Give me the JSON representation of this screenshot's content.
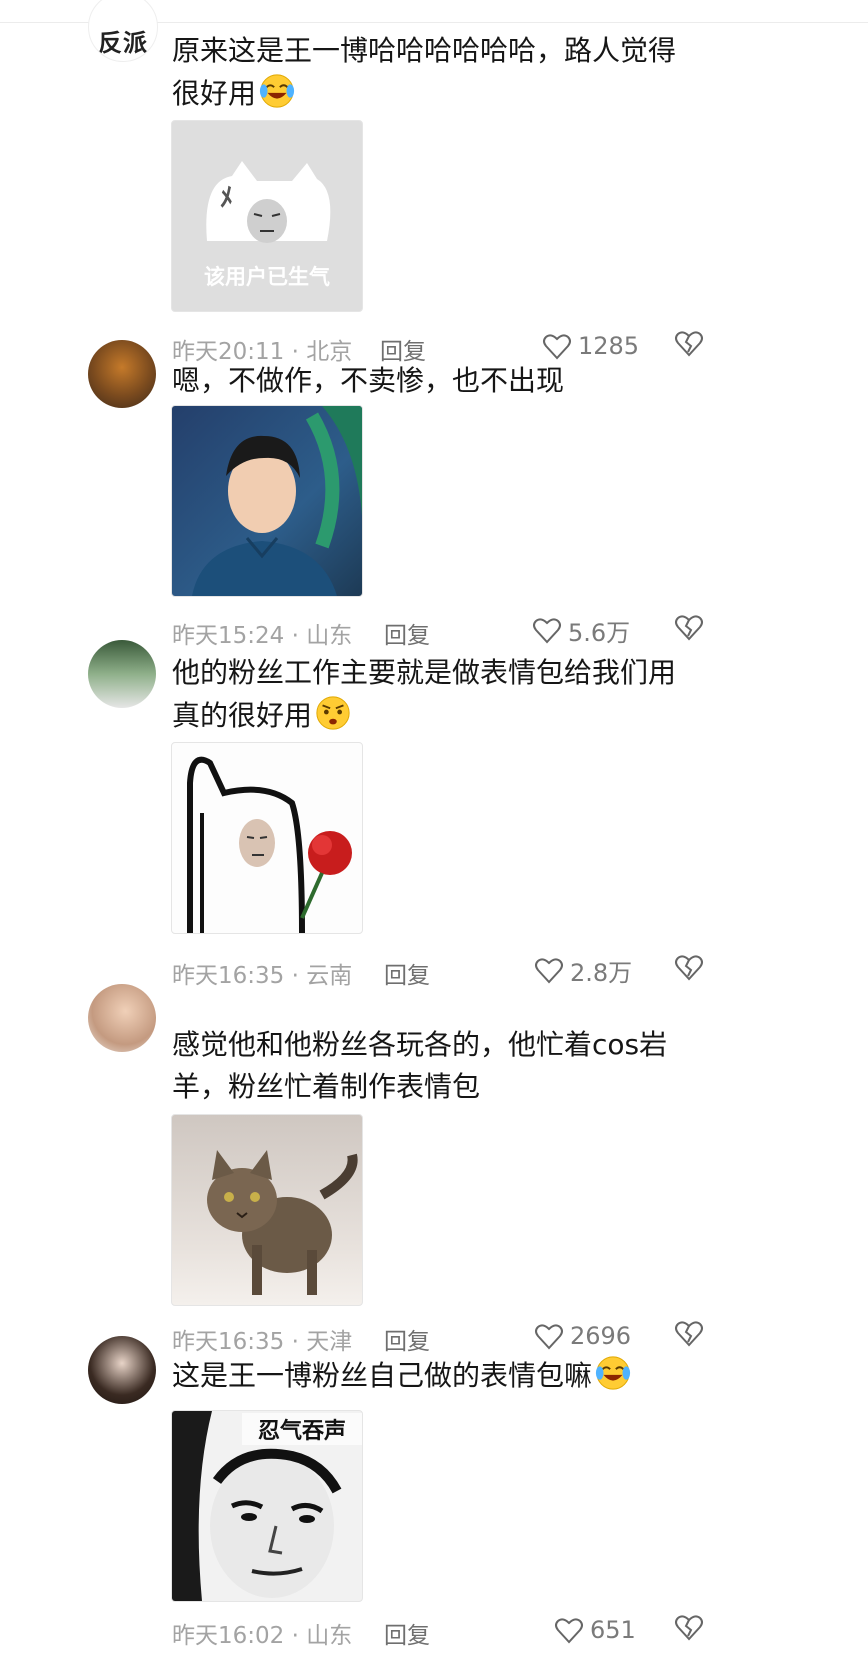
{
  "comments": [
    {
      "avatar_text": "反派",
      "text_line1": "原来这是王一博哈哈哈哈哈哈，路人觉得",
      "text_line2": "很好用",
      "emoji": "crying-laughing",
      "image_caption": "该用户已生气",
      "meta": "昨天20:11 · 北京",
      "reply": "回复",
      "likes": "1285"
    },
    {
      "text_line1": "嗯，不做作，不卖惨，也不出现",
      "meta": "昨天15:24 · 山东",
      "reply": "回复",
      "likes": "5.6万"
    },
    {
      "text_line1": "他的粉丝工作主要就是做表情包给我们用",
      "text_line2": "真的很好用",
      "emoji": "shocked-face",
      "meta": "昨天16:35 · 云南",
      "reply": "回复",
      "likes": "2.8万"
    },
    {
      "text_line1": "感觉他和他粉丝各玩各的，他忙着cos岩",
      "text_line2": "羊，粉丝忙着制作表情包",
      "meta": "昨天16:35 · 天津",
      "reply": "回复",
      "likes": "2696"
    },
    {
      "text_line1": "这是王一博粉丝自己做的表情包嘛",
      "emoji": "crying-laughing",
      "image_caption": "忍气吞声",
      "meta": "昨天16:02 · 山东",
      "reply": "回复",
      "likes": "651"
    }
  ],
  "icons": {
    "like": "heart-outline-icon",
    "dislike": "broken-heart-icon"
  },
  "colors": {
    "text": "#161616",
    "meta": "#a3a3a3",
    "reply": "#6f6f6f"
  }
}
